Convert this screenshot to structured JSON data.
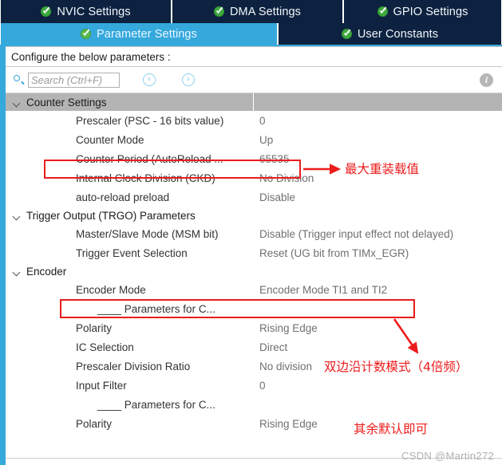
{
  "tabs": {
    "row1": [
      {
        "label": "NVIC Settings",
        "icon": "check-circle-icon",
        "active": false
      },
      {
        "label": "DMA Settings",
        "icon": "check-circle-icon",
        "active": false
      },
      {
        "label": "GPIO Settings",
        "icon": "check-circle-icon",
        "active": false
      }
    ],
    "row2": [
      {
        "label": "Parameter Settings",
        "icon": "check-circle-icon",
        "active": true
      },
      {
        "label": "User Constants",
        "icon": "check-circle-icon",
        "active": false
      }
    ]
  },
  "configure_line": "Configure the below parameters :",
  "toolbar": {
    "search_placeholder": "Search (Ctrl+F)",
    "search_value": "",
    "prev_label": "‹",
    "next_label": "›",
    "info_label": "i"
  },
  "groups": [
    {
      "title": "Counter Settings",
      "rows": [
        {
          "label": "Prescaler (PSC - 16 bits value)",
          "value": "0",
          "indent": "ind"
        },
        {
          "label": "Counter Mode",
          "value": "Up",
          "indent": "ind"
        },
        {
          "label": "Counter Period (AutoReload ...",
          "value": "65535",
          "indent": "ind"
        },
        {
          "label": "Internal Clock Division (CKD)",
          "value": "No Division",
          "indent": "ind"
        },
        {
          "label": "auto-reload preload",
          "value": "Disable",
          "indent": "ind"
        }
      ]
    },
    {
      "title": "Trigger Output (TRGO) Parameters",
      "rows": [
        {
          "label": "Master/Slave Mode (MSM bit)",
          "value": "Disable (Trigger input effect not delayed)",
          "indent": "ind"
        },
        {
          "label": "Trigger Event Selection",
          "value": "Reset (UG bit from TIMx_EGR)",
          "indent": "ind"
        }
      ]
    },
    {
      "title": "Encoder",
      "rows": [
        {
          "label": "Encoder Mode",
          "value": "Encoder Mode TI1 and TI2",
          "indent": "ind"
        },
        {
          "label": "____ Parameters for C...",
          "value": "",
          "indent": "sub"
        },
        {
          "label": "Polarity",
          "value": "Rising Edge",
          "indent": "ind"
        },
        {
          "label": "IC Selection",
          "value": "Direct",
          "indent": "ind"
        },
        {
          "label": "Prescaler Division Ratio",
          "value": "No division",
          "indent": "ind"
        },
        {
          "label": "Input Filter",
          "value": "0",
          "indent": "ind"
        },
        {
          "label": "____ Parameters for C...",
          "value": "",
          "indent": "sub"
        },
        {
          "label": "Polarity",
          "value": "Rising Edge",
          "indent": "ind"
        }
      ]
    }
  ],
  "annotations": [
    {
      "text": "最大重装载值",
      "name": "annotation-max-autoreload"
    },
    {
      "text": "双边沿计数模式（4倍频）",
      "name": "annotation-encoder-mode"
    },
    {
      "text": "其余默认即可",
      "name": "annotation-rest-default"
    }
  ],
  "watermark": "CSDN @Martin272",
  "colors": {
    "tab_inactive": "#0d2240",
    "tab_active": "#35a8dc",
    "group_header": "#b4b4b4",
    "annotation_red": "#ec1c1c",
    "check_green": "#3faa3f"
  }
}
